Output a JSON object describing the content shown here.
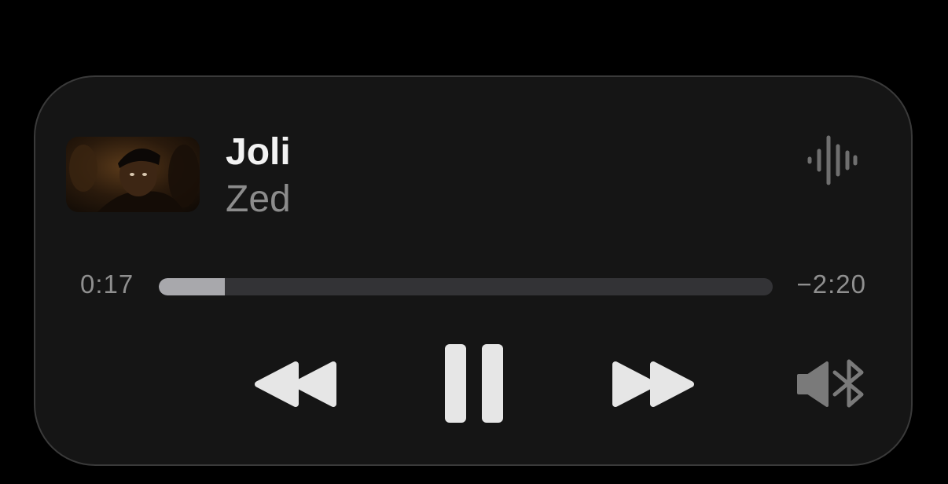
{
  "track": {
    "title": "Joli",
    "artist": "Zed"
  },
  "playback": {
    "elapsed": "0:17",
    "remaining": "−2:20",
    "progress_fraction": 0.108
  },
  "icons": {
    "waveform": "waveform-icon",
    "rewind": "rewind-icon",
    "pause": "pause-icon",
    "forward": "fast-forward-icon",
    "output": "speaker-bluetooth-icon"
  },
  "colors": {
    "background": "#000000",
    "card": "#151515",
    "title": "#f2f2f2",
    "artist": "#8c8c8c",
    "progress_fill": "#a8a8ac",
    "progress_track": "#333336",
    "controls": "#e6e6e6"
  }
}
